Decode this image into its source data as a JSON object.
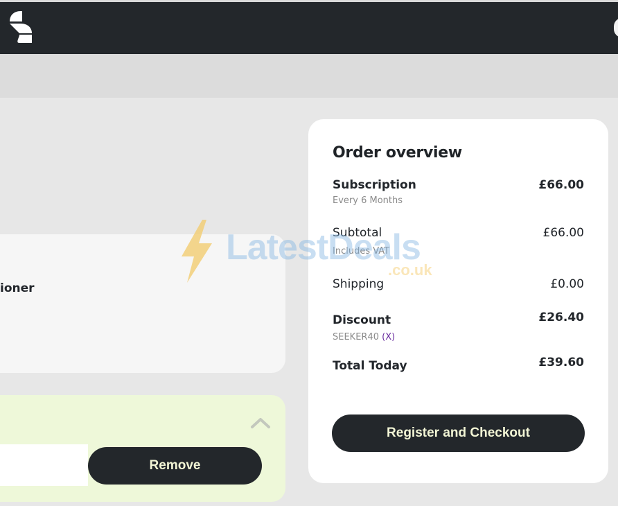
{
  "header": {
    "logo_icon": "brand-logo-icon"
  },
  "product": {
    "name": "ioner"
  },
  "promo": {
    "remove_label": "Remove",
    "collapse_icon": "chevron-up-icon",
    "input_value": ""
  },
  "overview": {
    "title": "Order overview",
    "subscription": {
      "label": "Subscription",
      "sub": "Every 6 Months",
      "value": "£66.00"
    },
    "subtotal": {
      "label": "Subtotal",
      "sub": "Includes VAT",
      "value": "£66.00"
    },
    "shipping": {
      "label": "Shipping",
      "value": "£0.00"
    },
    "discount": {
      "label": "Discount",
      "code": "SEEKER40",
      "remove": "(X)",
      "value": "£26.40"
    },
    "total": {
      "label": "Total Today",
      "value": "£39.60"
    },
    "checkout_label": "Register and Checkout"
  },
  "watermark": {
    "text": "LatestDeals",
    "sub": ".co.uk"
  },
  "colors": {
    "navbar": "#23272b",
    "button_bg": "#23272b",
    "button_text": "#f2f5d5",
    "promo_bg": "#eef8d9",
    "accent_purple": "#6b2fa0"
  }
}
